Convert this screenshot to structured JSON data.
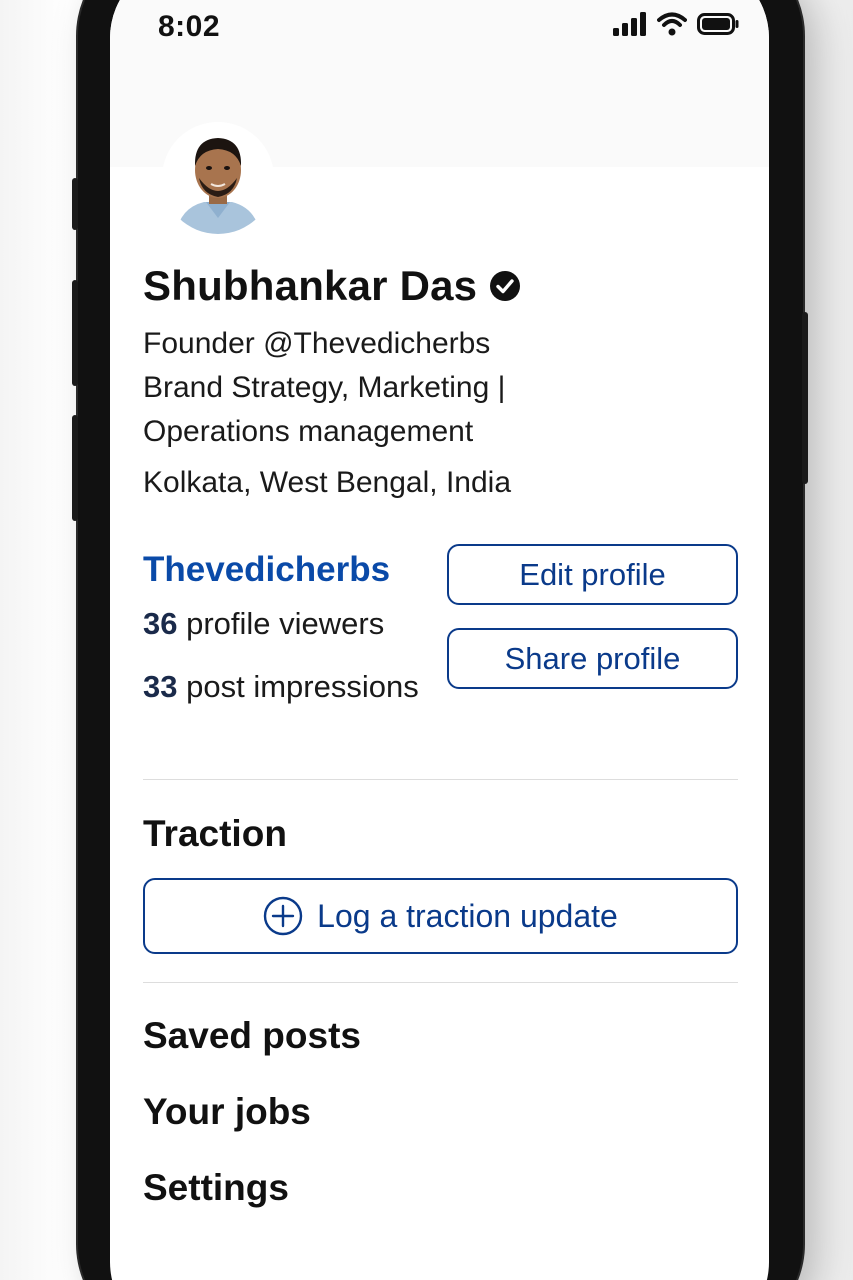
{
  "status_bar": {
    "time": "8:02",
    "icons": [
      "signal-icon",
      "wifi-icon",
      "battery-icon"
    ]
  },
  "profile": {
    "name": "Shubhankar Das",
    "verified_icon": "verified-check-icon",
    "headline_lines": [
      "Founder @Thevedicherbs",
      "Brand Strategy, Marketing |",
      "Operations management"
    ],
    "location": "Kolkata, West Bengal, India",
    "company_link": "Thevedicherbs"
  },
  "actions": {
    "edit_profile": "Edit profile",
    "share_profile": "Share profile"
  },
  "stats": {
    "profile_viewers_count": "36",
    "profile_viewers_label": "profile viewers",
    "post_impressions_count": "33",
    "post_impressions_label": "post impressions"
  },
  "traction": {
    "title": "Traction",
    "log_button": "Log a traction update",
    "log_icon": "plus-circle-icon"
  },
  "menu": {
    "items": [
      "Saved posts",
      "Your jobs",
      "Settings"
    ]
  },
  "colors": {
    "accent_blue": "#0a4aa8",
    "button_border": "#0a3a8a",
    "text_primary": "#111111"
  }
}
